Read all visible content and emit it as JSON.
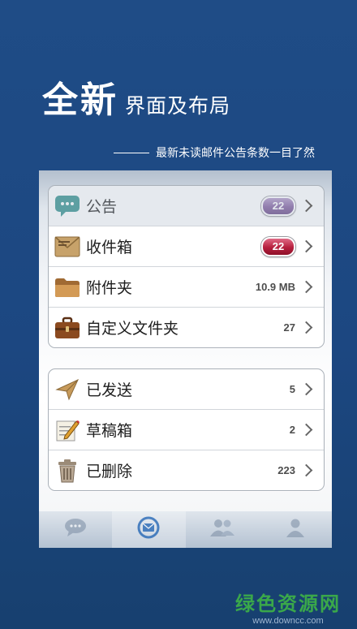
{
  "headline": {
    "big": "全新",
    "small": "界面及布局"
  },
  "subline": "最新未读邮件公告条数一目了然",
  "group1": [
    {
      "icon": "chat-bubble-icon",
      "label": "公告",
      "badge": "22"
    },
    {
      "icon": "envelope-icon",
      "label": "收件箱",
      "badge": "22"
    },
    {
      "icon": "folder-icon",
      "label": "附件夹",
      "value": "10.9 MB"
    },
    {
      "icon": "briefcase-icon",
      "label": "自定义文件夹",
      "value": "27"
    }
  ],
  "group2": [
    {
      "icon": "paper-plane-icon",
      "label": "已发送",
      "value": "5"
    },
    {
      "icon": "pencil-note-icon",
      "label": "草稿箱",
      "value": "2"
    },
    {
      "icon": "trash-can-icon",
      "label": "已删除",
      "value": "223"
    }
  ],
  "tabs": [
    {
      "icon": "chat-icon"
    },
    {
      "icon": "mail-globe-icon",
      "active": true
    },
    {
      "icon": "contacts-icon"
    },
    {
      "icon": "person-icon"
    }
  ],
  "watermark": {
    "cn": "绿色资源网",
    "en": "www.downcc.com"
  }
}
